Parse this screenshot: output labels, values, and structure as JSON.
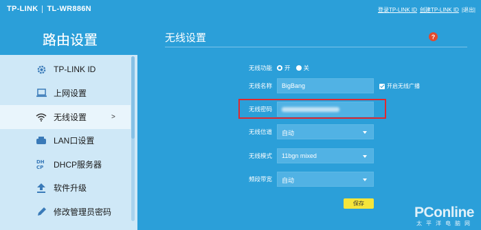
{
  "header": {
    "brand": "TP-LINK",
    "model": "TL-WR886N",
    "links": [
      "登录TP-LINK ID",
      "创建TP-LINK ID",
      "|退出|"
    ]
  },
  "sidebar": {
    "title": "路由设置",
    "items": [
      {
        "label": "TP-LINK ID",
        "icon": "gear-icon",
        "active": false
      },
      {
        "label": "上网设置",
        "icon": "monitor-icon",
        "active": false
      },
      {
        "label": "无线设置",
        "icon": "wifi-icon",
        "active": true,
        "arrow": ">"
      },
      {
        "label": "LAN口设置",
        "icon": "router-icon",
        "active": false
      },
      {
        "label": "DHCP服务器",
        "icon": "dhcp-icon",
        "active": false
      },
      {
        "label": "软件升级",
        "icon": "upload-icon",
        "active": false
      },
      {
        "label": "修改管理员密码",
        "icon": "pencil-icon",
        "active": false
      }
    ]
  },
  "main": {
    "title": "无线设置",
    "help": "?",
    "form": {
      "wireless_label": "无线功能",
      "wireless_on": "开",
      "wireless_off": "关",
      "ssid_label": "无线名称",
      "ssid_value": "BigBang",
      "broadcast_label": "开启无线广播",
      "password_label": "无线密码",
      "channel_label": "无线信道",
      "channel_value": "自动",
      "mode_label": "无线模式",
      "mode_value": "11bgn mixed",
      "bandwidth_label": "频段带宽",
      "bandwidth_value": "自动",
      "save_label": "保存"
    }
  },
  "watermark": {
    "main": "PConline",
    "sub": "太平洋电脑网"
  },
  "colors": {
    "background": "#2b9fd9",
    "sidebar": "#cfe8f7",
    "highlight_box": "#e0282e",
    "save_button": "#f5e53a",
    "help_icon": "#e24a2e"
  }
}
